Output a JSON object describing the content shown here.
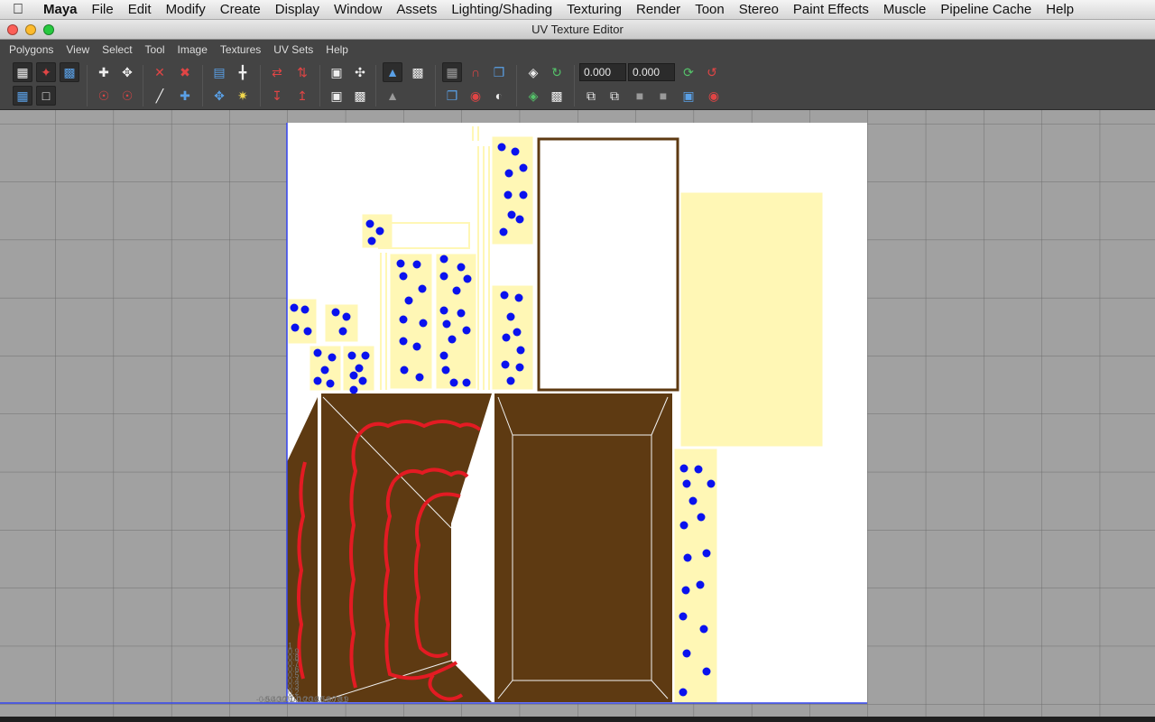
{
  "mac_menu": {
    "apple": "",
    "items": [
      "Maya",
      "File",
      "Edit",
      "Modify",
      "Create",
      "Display",
      "Window",
      "Assets",
      "Lighting/Shading",
      "Texturing",
      "Render",
      "Toon",
      "Stereo",
      "Paint Effects",
      "Muscle",
      "Pipeline Cache",
      "Help"
    ]
  },
  "window": {
    "title": "UV Texture Editor"
  },
  "editor_menu": [
    "Polygons",
    "View",
    "Select",
    "Tool",
    "Image",
    "Textures",
    "UV Sets",
    "Help"
  ],
  "toolbar": {
    "u_value": "0.000",
    "v_value": "0.000",
    "icons": [
      "uv-grid-icon",
      "uv-lattice-icon",
      "uv-smudge-icon",
      "move-uv-icon",
      "rotate-uv-icon",
      "cut-uv-icon",
      "sew-uv-icon",
      "split-uv-icon",
      "layout-uv-icon",
      "flip-u-icon",
      "flip-v-icon",
      "align-u-icon",
      "align-v-icon",
      "snap-icon",
      "image-display-icon",
      "checker-icon",
      "grid-toggle-icon",
      "magnet-icon",
      "isolate-icon",
      "dim-image-icon",
      "psd-icon",
      "shaded-uv-icon",
      "copy-icon",
      "paste-icon",
      "delete-icon",
      "stamp-icon",
      "texture-borders-icon",
      "distortion-icon"
    ]
  },
  "grid": {
    "x_ticks": [
      "-0.5",
      "-0.4",
      "-0.3",
      "-0.2",
      "-0.1",
      "0",
      "0.1",
      "0.2",
      "0.3",
      "0.4",
      "0.5",
      "0.6",
      "0.7",
      "0.8",
      "0.9",
      "1"
    ],
    "y_ticks": [
      "0.1",
      "0.2",
      "0.3",
      "0.4",
      "0.5",
      "0.6",
      "0.7",
      "0.8",
      "0.9",
      "1"
    ]
  },
  "colors": {
    "viewport_bg": "#a1a1a1",
    "texture_white": "#ffffff",
    "shell_yellow": "#fff7b5",
    "dot_blue": "#0a12ee",
    "wood_brown": "#5e3a12",
    "stripe_red": "#e31b23",
    "grid_line": "#6e6e6e",
    "v_axis": "#3344ee",
    "u_axis": "#3344ee"
  }
}
